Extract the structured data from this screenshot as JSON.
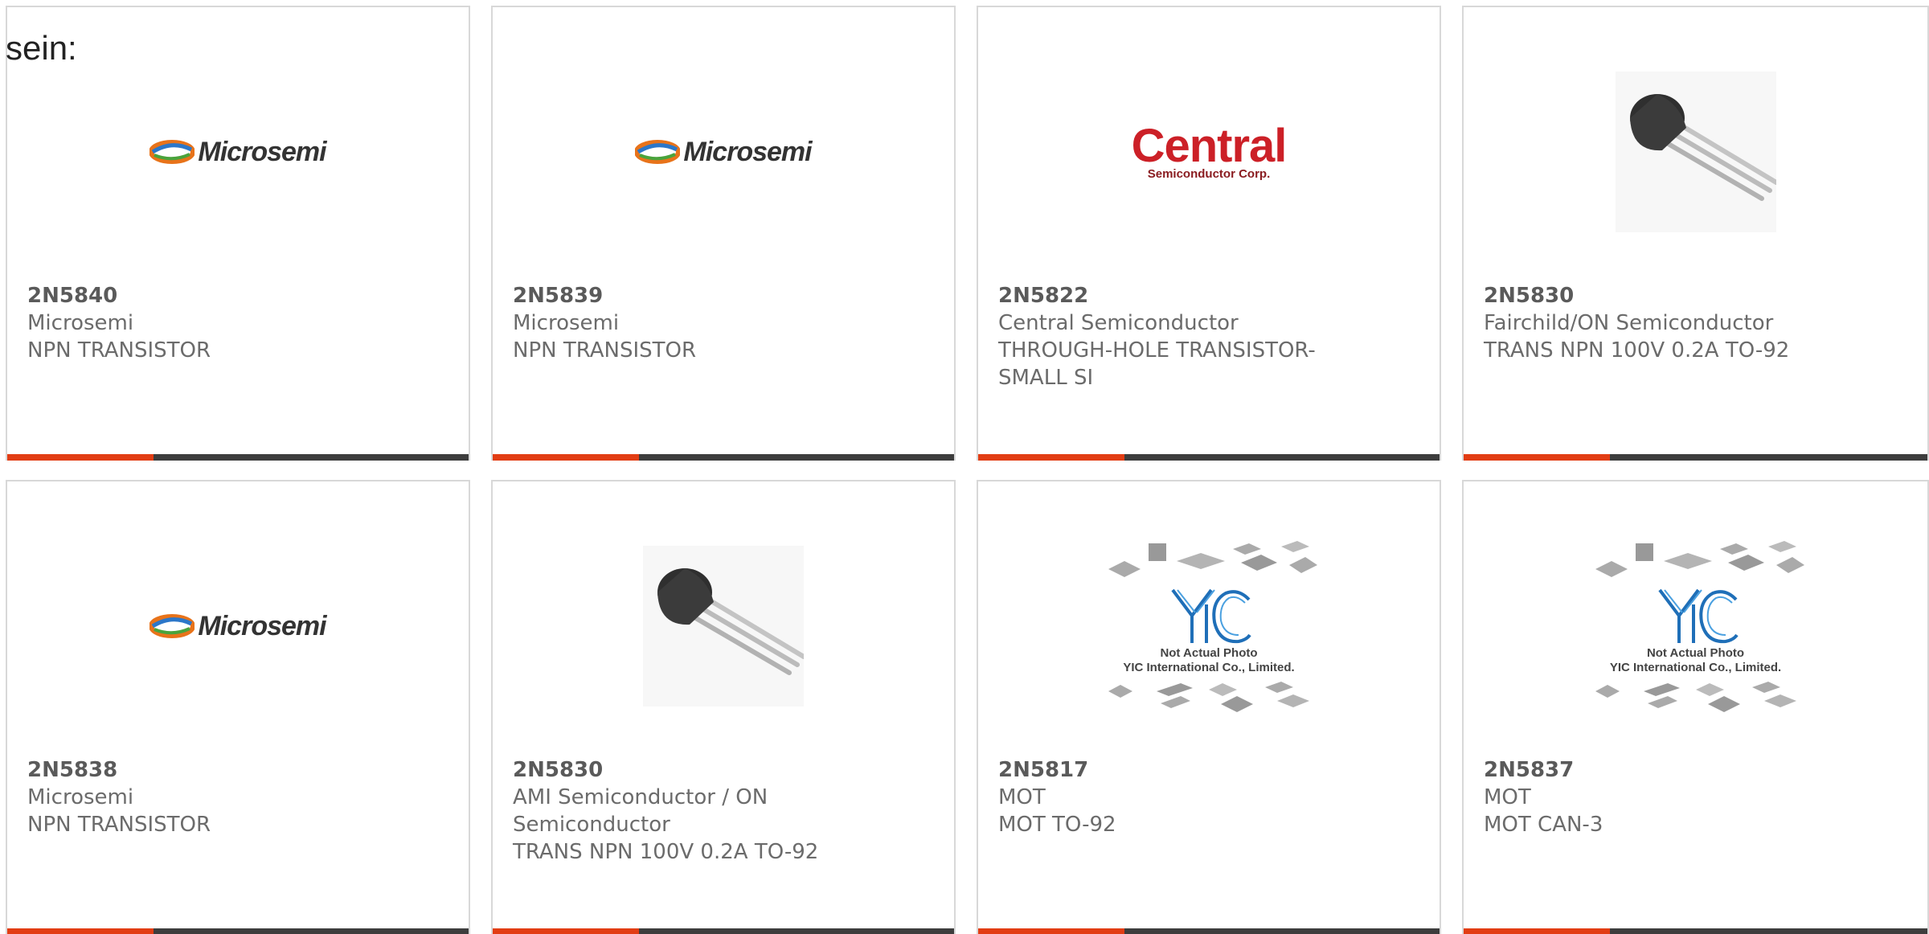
{
  "intro_text": "sein:",
  "logos": {
    "microsemi": "Microsemi",
    "central_big": "Central",
    "central_small": "Semiconductor Corp.",
    "yic_caption_1": "Not Actual Photo",
    "yic_caption_2": "YIC International Co., Limited."
  },
  "colors": {
    "accent": "#e23d14",
    "bar": "#3d3d3d",
    "text": "#6b6b6b",
    "central_red": "#cc2027"
  },
  "products": [
    {
      "part": "2N5840",
      "manufacturer": "Microsemi",
      "description": "NPN TRANSISTOR",
      "image": "microsemi-logo"
    },
    {
      "part": "2N5839",
      "manufacturer": "Microsemi",
      "description": "NPN TRANSISTOR",
      "image": "microsemi-logo"
    },
    {
      "part": "2N5822",
      "manufacturer": "Central Semiconductor",
      "description": "THROUGH-HOLE TRANSISTOR-SMALL SI",
      "image": "central-logo"
    },
    {
      "part": "2N5830",
      "manufacturer": "Fairchild/ON Semiconductor",
      "description": "TRANS NPN 100V 0.2A TO-92",
      "image": "to92-transistor-photo"
    },
    {
      "part": "2N5838",
      "manufacturer": "Microsemi",
      "description": "NPN TRANSISTOR",
      "image": "microsemi-logo"
    },
    {
      "part": "2N5830",
      "manufacturer": "AMI Semiconductor / ON Semiconductor",
      "description": "TRANS NPN 100V 0.2A TO-92",
      "image": "to92-transistor-photo"
    },
    {
      "part": "2N5817",
      "manufacturer": "MOT",
      "description": "MOT TO-92",
      "image": "yic-placeholder"
    },
    {
      "part": "2N5837",
      "manufacturer": "MOT",
      "description": "MOT CAN-3",
      "image": "yic-placeholder"
    }
  ]
}
